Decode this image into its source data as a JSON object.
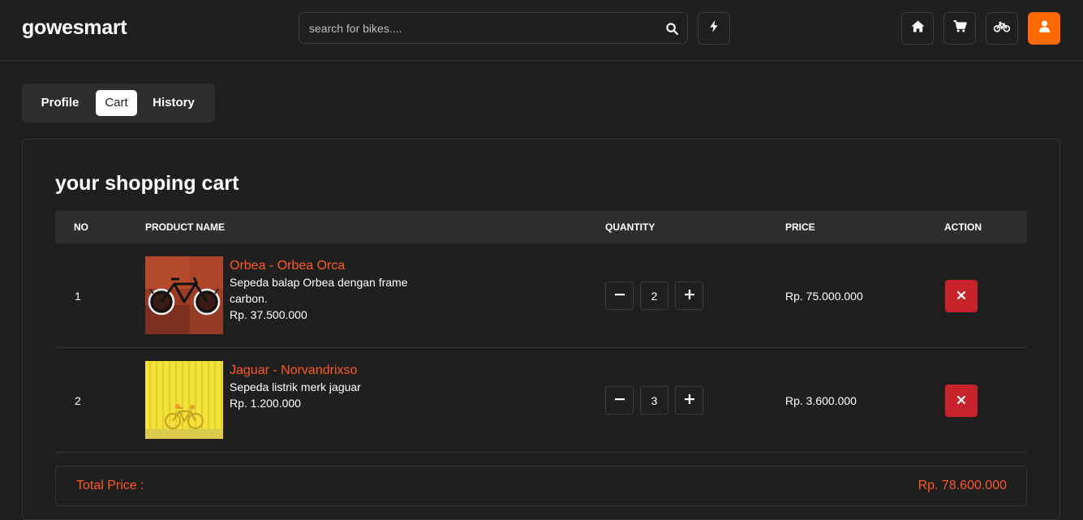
{
  "header": {
    "logo": "gowesmart",
    "search_placeholder": "search for bikes....",
    "accent_color": "#ff6a00",
    "icons": [
      "search-icon",
      "bolt-icon",
      "home-icon",
      "cart-icon",
      "bike-icon",
      "user-icon"
    ]
  },
  "tabs": [
    {
      "label": "Profile",
      "active": false
    },
    {
      "label": "Cart",
      "active": true
    },
    {
      "label": "History",
      "active": false
    }
  ],
  "cart": {
    "title": "your shopping cart",
    "columns": [
      "NO",
      "PRODUCT NAME",
      "QUANTITY",
      "PRICE",
      "ACTION"
    ],
    "items": [
      {
        "no": "1",
        "name": "Orbea - Orbea Orca",
        "description": "Sepeda balap Orbea dengan frame carbon.",
        "unit_price": "Rp. 37.500.000",
        "quantity": "2",
        "price": "Rp. 75.000.000"
      },
      {
        "no": "2",
        "name": "Jaguar - Norvandrixso",
        "description": "Sepeda listrik merk jaguar",
        "unit_price": "Rp. 1.200.000",
        "quantity": "3",
        "price": "Rp. 3.600.000"
      }
    ],
    "total_label": "Total Price :",
    "total_value": "Rp. 78.600.000",
    "remove_color": "#c8232c",
    "highlight_color": "#ff5a1f"
  }
}
